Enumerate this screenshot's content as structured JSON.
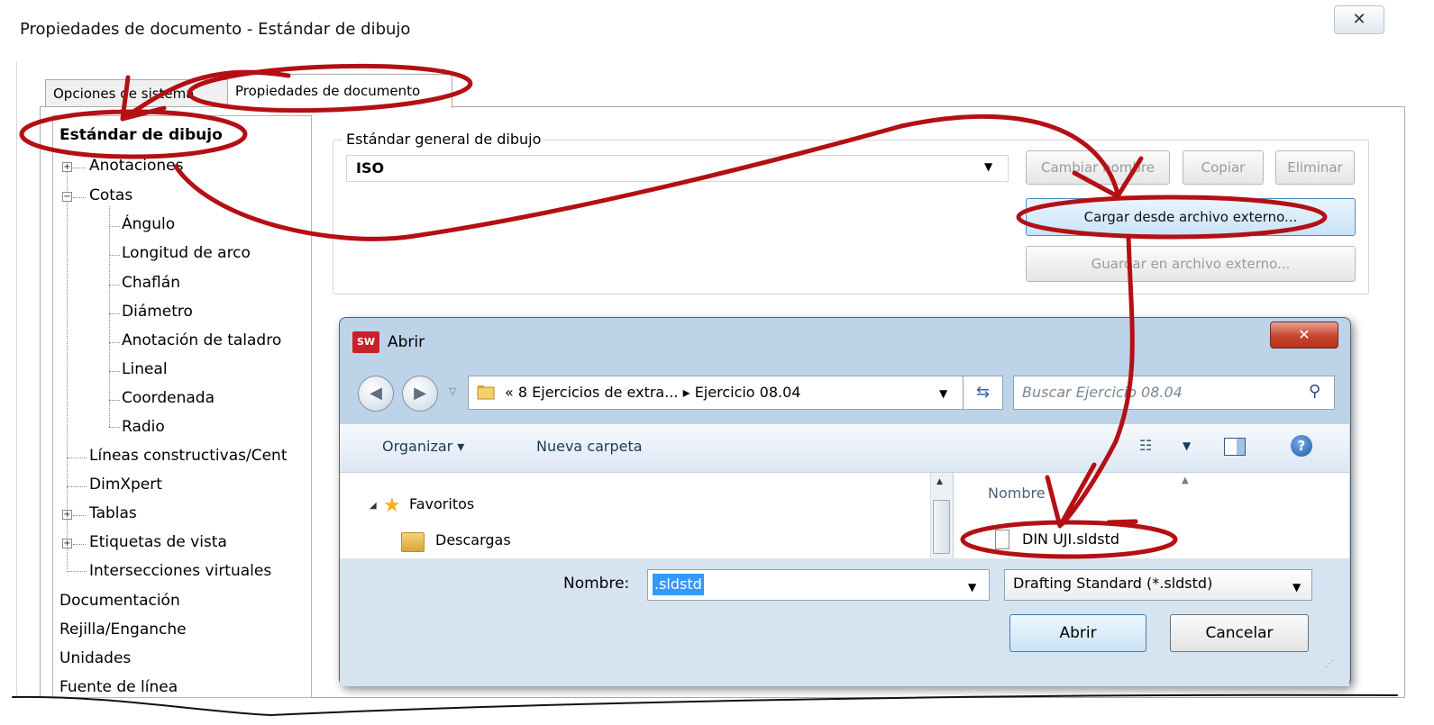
{
  "window": {
    "title": "Propiedades de documento - Estándar de dibujo",
    "close_glyph": "✕"
  },
  "tabs": [
    {
      "label": "Opciones de sistema"
    },
    {
      "label": "Propiedades de documento"
    }
  ],
  "tree": {
    "items": [
      {
        "label": "Estándar de dibujo",
        "selected": true
      },
      {
        "label": "Anotaciones",
        "expander": "+"
      },
      {
        "label": "Cotas",
        "expander": "−"
      },
      {
        "label": "Ángulo"
      },
      {
        "label": "Longitud de arco"
      },
      {
        "label": "Chaflán"
      },
      {
        "label": "Diámetro"
      },
      {
        "label": "Anotación de taladro"
      },
      {
        "label": "Lineal"
      },
      {
        "label": "Coordenada"
      },
      {
        "label": "Radio"
      },
      {
        "label": "Líneas constructivas/Cent"
      },
      {
        "label": "DimXpert"
      },
      {
        "label": "Tablas",
        "expander": "+"
      },
      {
        "label": "Etiquetas de vista",
        "expander": "+"
      },
      {
        "label": "Intersecciones virtuales"
      },
      {
        "label": "Documentación"
      },
      {
        "label": "Rejilla/Enganche"
      },
      {
        "label": "Unidades"
      },
      {
        "label": "Fuente de línea"
      }
    ]
  },
  "standard": {
    "group_label": "Estándar general de dibujo",
    "value": "ISO",
    "rename_label": "Cambiar nombre",
    "copy_label": "Copiar",
    "delete_label": "Eliminar",
    "load_label": "Cargar desde archivo externo...",
    "save_label": "Guardar en archivo externo..."
  },
  "open_dialog": {
    "title": "Abrir",
    "logo_text": "SW",
    "breadcrumb": "« 8 Ejercicios de extra... ▸ Ejercicio 08.04",
    "search_placeholder": "Buscar Ejercicio 08.04",
    "organize_label": "Organizar ▾",
    "new_folder_label": "Nueva carpeta",
    "nav": {
      "favorites_label": "Favoritos",
      "downloads_label": "Descargas"
    },
    "column_name": "Nombre",
    "file_name": "DIN UJI.sldstd",
    "filename_label": "Nombre:",
    "filename_value": ".sldstd",
    "filter_value": "Drafting Standard (*.sldstd)",
    "open_label": "Abrir",
    "cancel_label": "Cancelar",
    "close_glyph": "✕"
  },
  "icons": {
    "back": "back-arrow-icon",
    "forward": "forward-arrow-icon",
    "refresh": "refresh-icon",
    "search": "search-icon",
    "help": "help-icon",
    "folder": "folder-icon",
    "star": "star-icon",
    "file": "file-icon"
  },
  "colors": {
    "annotation": "#b40f14",
    "accent_blue": "#3399ff",
    "dialog_frame": "#bcd3e8"
  }
}
